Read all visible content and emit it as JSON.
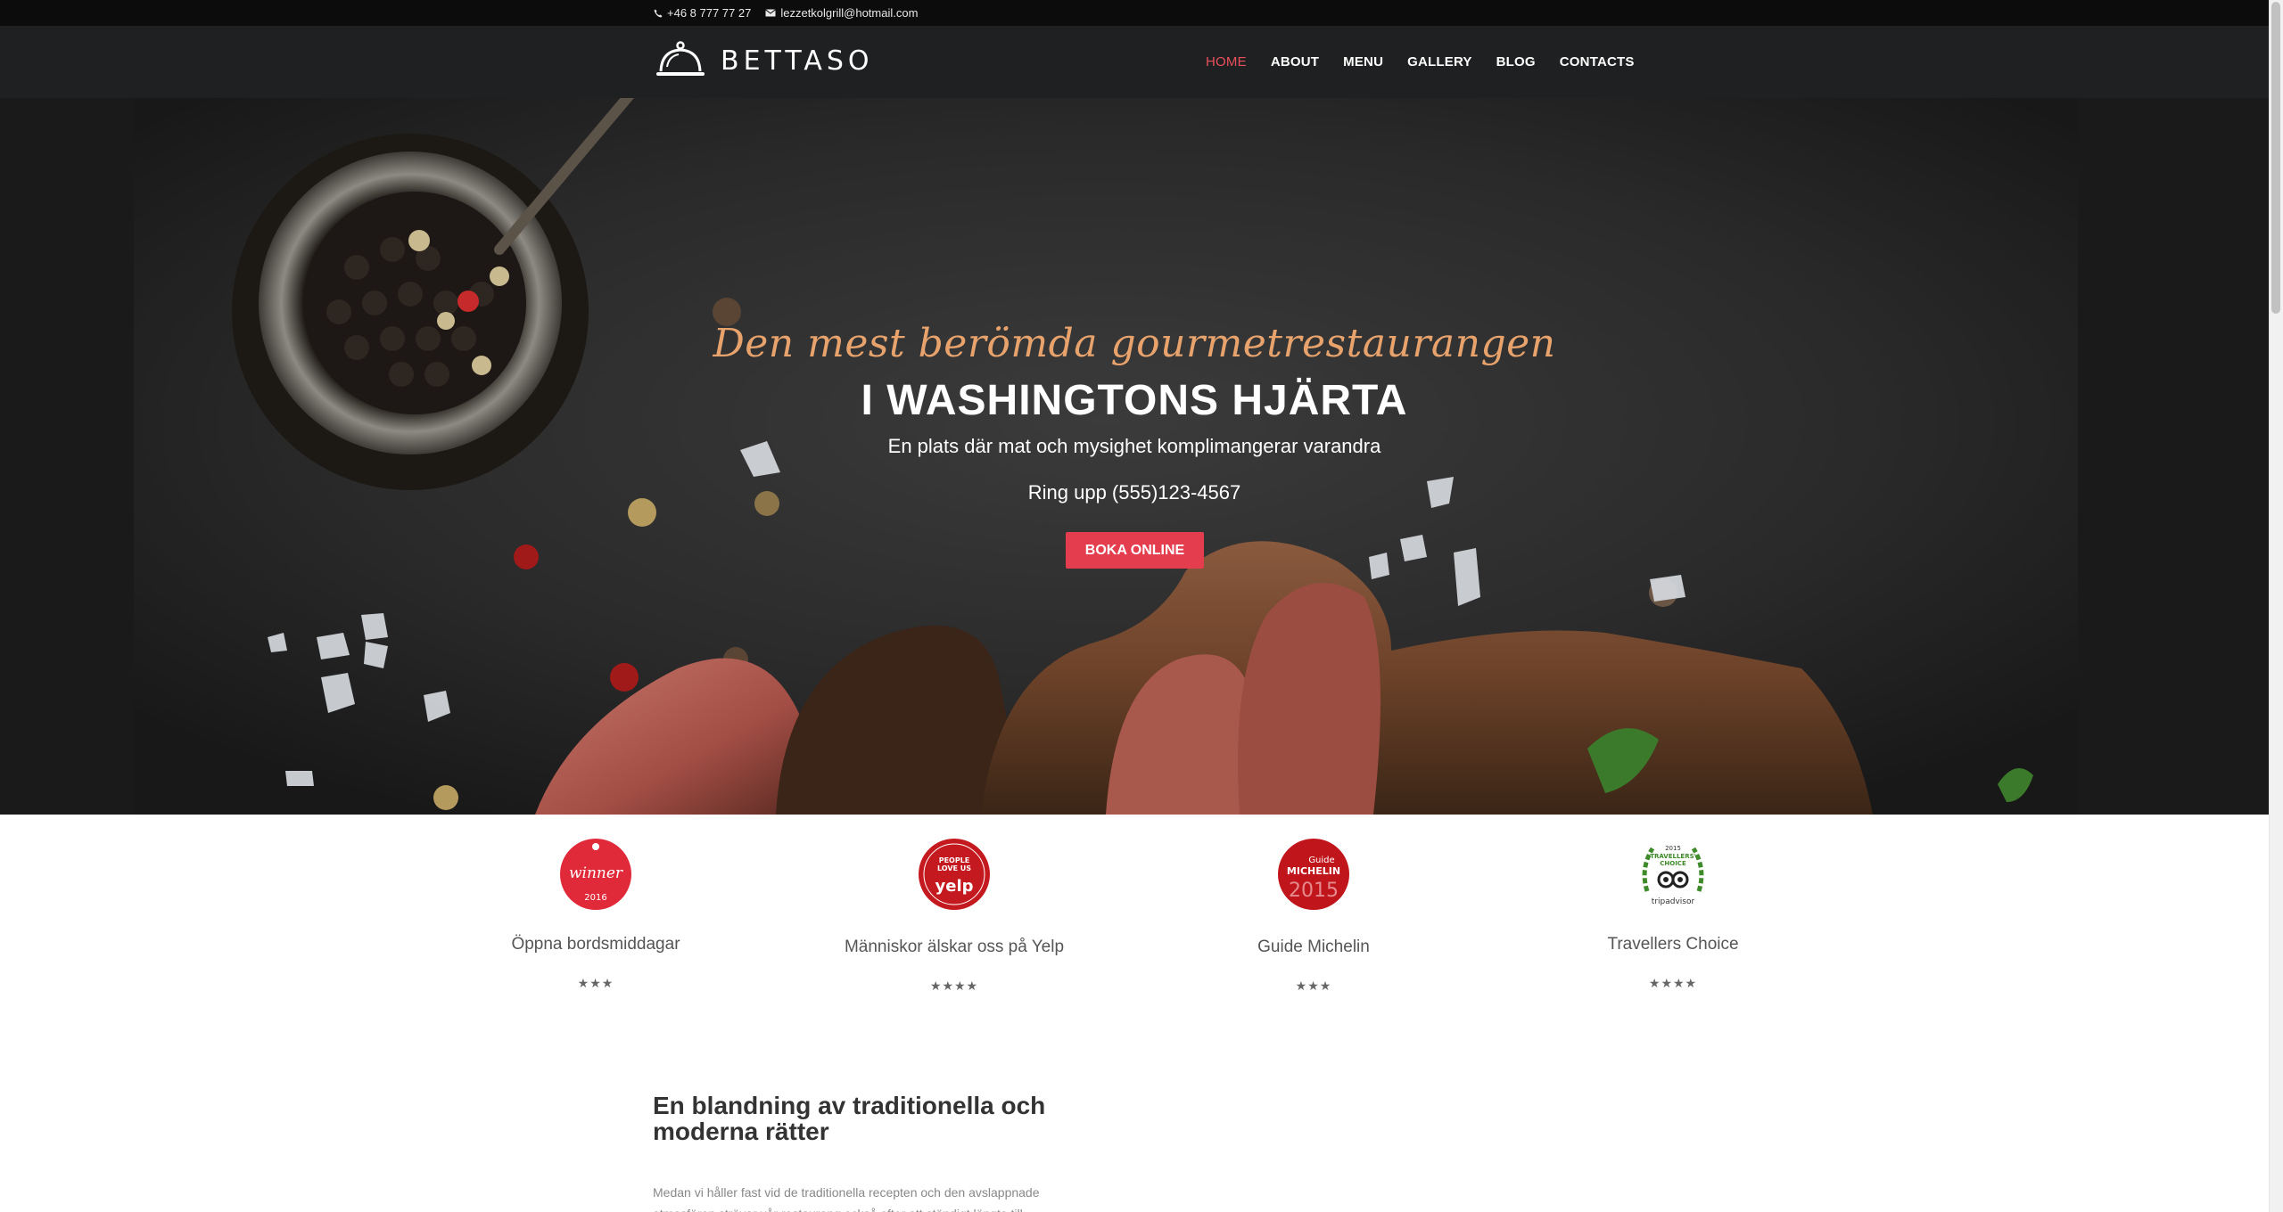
{
  "topbar": {
    "phone": "+46 8 777 77 27",
    "email": "lezzetkolgrill@hotmail.com",
    "phone_icon": "phone-icon",
    "email_icon": "envelope-icon"
  },
  "header": {
    "logo_text": "BETTASO",
    "logo_icon": "cloche-icon",
    "nav": [
      {
        "label": "HOME",
        "active": true
      },
      {
        "label": "ABOUT"
      },
      {
        "label": "MENU"
      },
      {
        "label": "GALLERY"
      },
      {
        "label": "BLOG"
      },
      {
        "label": "CONTACTS"
      }
    ]
  },
  "hero": {
    "script_title": "Den mest berömda gourmetrestaurangen",
    "headline": "I WASHINGTONS HJÄRTA",
    "subtitle": "En plats där mat och mysighet komplimangerar varandra",
    "phone_line": "Ring upp (555)123-4567",
    "cta_label": "BOKA ONLINE"
  },
  "awards": [
    {
      "badge_text": "winner",
      "label": "Öppna bordsmiddagar",
      "stars": "★★★",
      "icon": "opentable-winner-badge-icon"
    },
    {
      "badge_text": "yelp",
      "label": "Människor älskar oss på Yelp",
      "stars": "★★★★",
      "icon": "yelp-badge-icon"
    },
    {
      "badge_text": "MICHELIN",
      "label": "Guide Michelin",
      "stars": "★★★",
      "icon": "michelin-badge-icon"
    },
    {
      "badge_text": "tripadvisor",
      "label": "Travellers Choice",
      "stars": "★★★★",
      "icon": "tripadvisor-badge-icon"
    }
  ],
  "content": {
    "title": "En blandning av traditionella och moderna rätter",
    "body": "Medan vi håller fast vid de traditionella recepten och den avslappnade atmosfären strävar vår restaurang också efter att ständigt längta till"
  },
  "colors": {
    "accent": "#e33d4e",
    "nav_active": "#e8505b",
    "script": "#e8a36d",
    "header_bg": "#1f2021",
    "topbar_bg": "#0c0c0c"
  }
}
